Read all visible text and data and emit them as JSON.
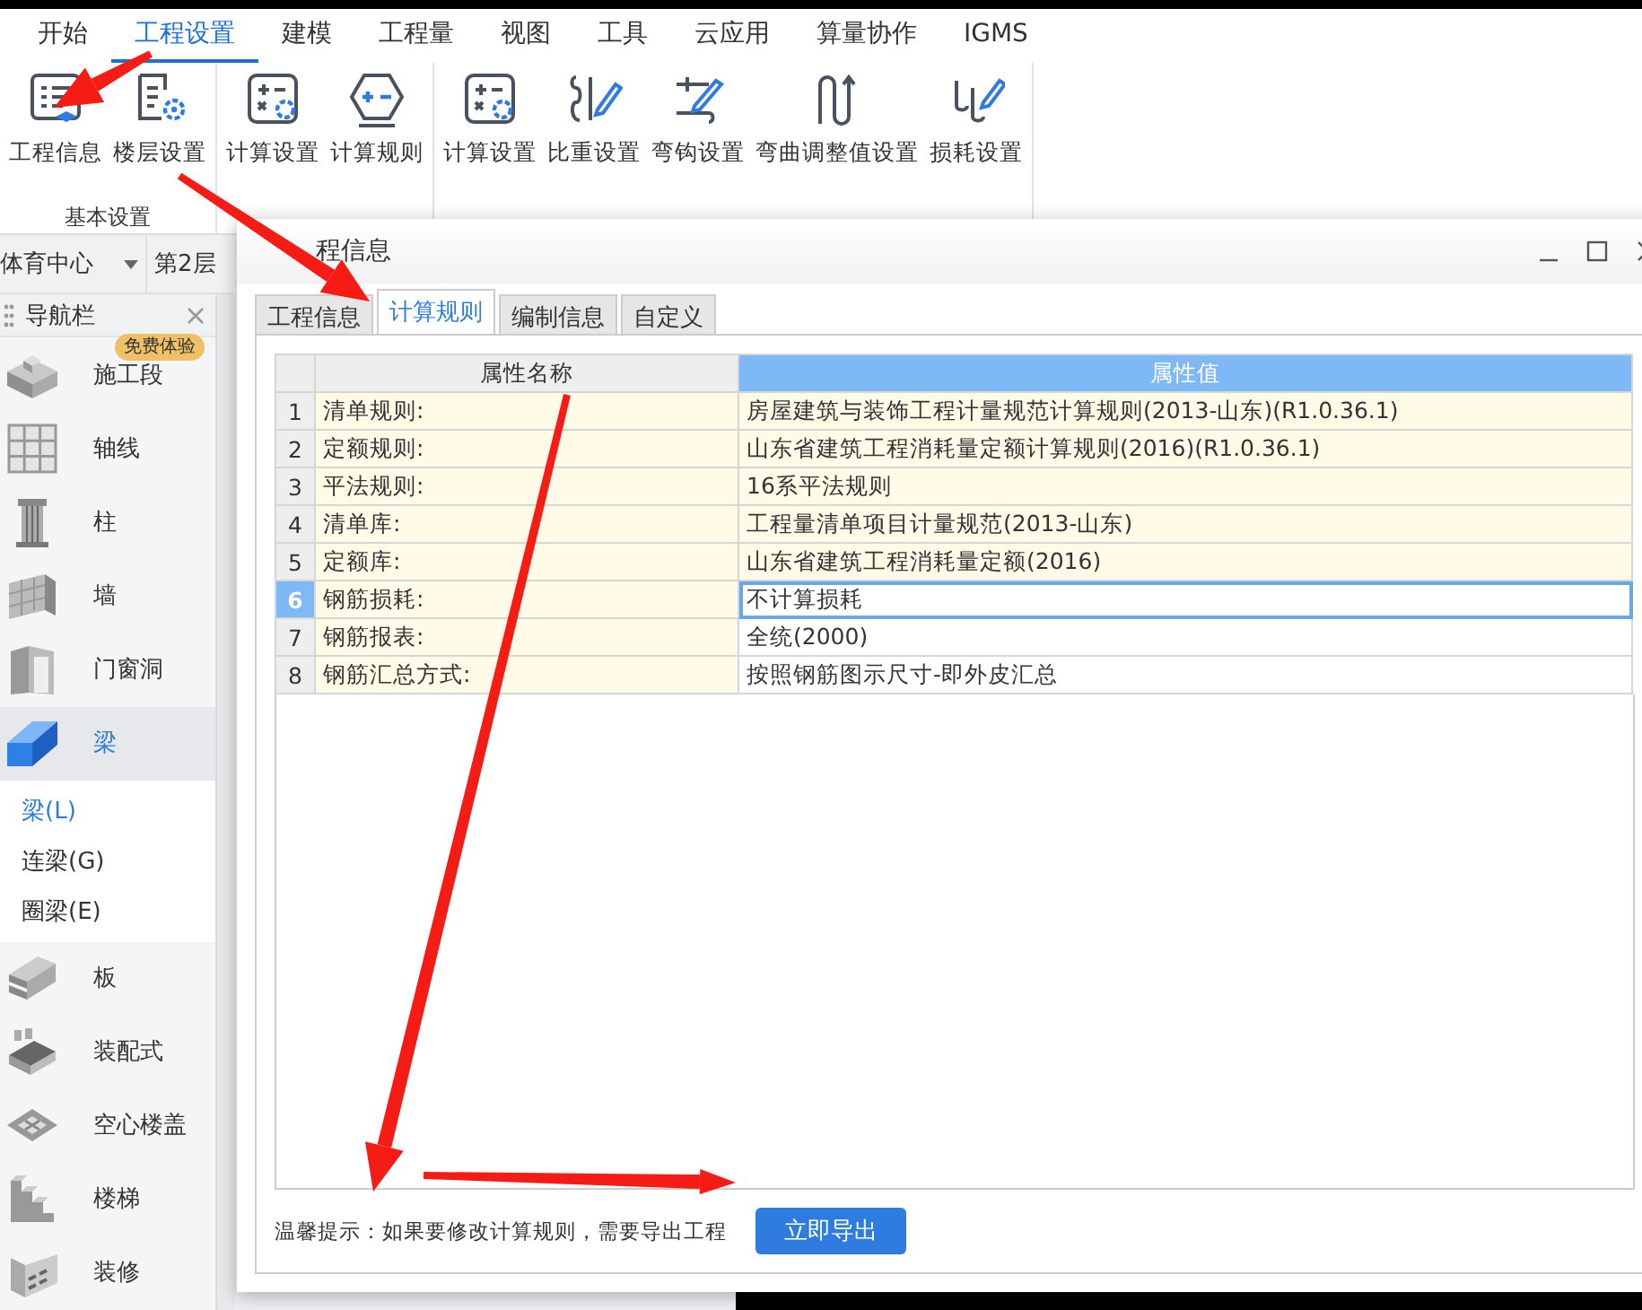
{
  "menu_tabs": [
    {
      "label": "开始",
      "selected": false
    },
    {
      "label": "工程设置",
      "selected": true
    },
    {
      "label": "建模",
      "selected": false
    },
    {
      "label": "工程量",
      "selected": false
    },
    {
      "label": "视图",
      "selected": false
    },
    {
      "label": "工具",
      "selected": false
    },
    {
      "label": "云应用",
      "selected": false
    },
    {
      "label": "算量协作",
      "selected": false
    },
    {
      "label": "IGMS",
      "selected": false
    }
  ],
  "ribbon_groups": [
    {
      "label": "基本设置",
      "buttons": [
        {
          "label": "工程信息",
          "kind": "docs"
        },
        {
          "label": "楼层设置",
          "kind": "docgear"
        }
      ]
    },
    {
      "buttons": [
        {
          "label": "计算设置",
          "kind": "calcgear"
        },
        {
          "label": "计算规则",
          "kind": "hexcalc"
        }
      ]
    },
    {
      "buttons": [
        {
          "label": "计算设置",
          "kind": "calcgear"
        },
        {
          "label": "比重设置",
          "kind": "barpencil"
        },
        {
          "label": "弯钩设置",
          "kind": "hookpencil"
        },
        {
          "label": "弯曲调整值设置",
          "kind": "wave"
        },
        {
          "label": "损耗设置",
          "kind": "hooks"
        }
      ]
    }
  ],
  "project_select": {
    "value": "体育中心"
  },
  "floor_select": {
    "value": "第2层"
  },
  "nav_panel": {
    "title": "导航栏",
    "badge": "免费体验",
    "items": [
      {
        "label": "施工段",
        "kind": "block",
        "selected": false
      },
      {
        "label": "轴线",
        "kind": "grid",
        "selected": false
      },
      {
        "label": "柱",
        "kind": "column",
        "selected": false
      },
      {
        "label": "墙",
        "kind": "wall",
        "selected": false
      },
      {
        "label": "门窗洞",
        "kind": "door",
        "selected": false
      },
      {
        "label": "梁",
        "kind": "beam",
        "selected": true,
        "children": [
          {
            "label": "梁(L)",
            "selected": true
          },
          {
            "label": "连梁(G)",
            "selected": false
          },
          {
            "label": "圈梁(E)",
            "selected": false
          }
        ]
      },
      {
        "label": "板",
        "kind": "slab",
        "selected": false
      },
      {
        "label": "装配式",
        "kind": "precast",
        "selected": false
      },
      {
        "label": "空心楼盖",
        "kind": "hollow",
        "selected": false
      },
      {
        "label": "楼梯",
        "kind": "stairs",
        "selected": false
      },
      {
        "label": "装修",
        "kind": "finish",
        "selected": false
      }
    ]
  },
  "dialog": {
    "title": "程信息",
    "tabs": [
      {
        "label": "工程信息",
        "selected": false
      },
      {
        "label": "计算规则",
        "selected": true
      },
      {
        "label": "编制信息",
        "selected": false
      },
      {
        "label": "自定义",
        "selected": false
      }
    ],
    "table": {
      "columns": [
        "属性名称",
        "属性值"
      ],
      "rows": [
        {
          "number": "1",
          "name": "清单规则:",
          "value": "房屋建筑与装饰工程计量规范计算规则(2013-山东)(R1.0.36.1)",
          "shaded": true,
          "selected": false
        },
        {
          "number": "2",
          "name": "定额规则:",
          "value": "山东省建筑工程消耗量定额计算规则(2016)(R1.0.36.1)",
          "shaded": true,
          "selected": false
        },
        {
          "number": "3",
          "name": "平法规则:",
          "value": "16系平法规则",
          "shaded": true,
          "selected": false
        },
        {
          "number": "4",
          "name": "清单库:",
          "value": "工程量清单项目计量规范(2013-山东)",
          "shaded": true,
          "selected": false
        },
        {
          "number": "5",
          "name": "定额库:",
          "value": "山东省建筑工程消耗量定额(2016)",
          "shaded": true,
          "selected": false
        },
        {
          "number": "6",
          "name": "钢筋损耗:",
          "value": "不计算损耗",
          "shaded": false,
          "selected": true
        },
        {
          "number": "7",
          "name": "钢筋报表:",
          "value": "全统(2000)",
          "shaded": false,
          "selected": false
        },
        {
          "number": "8",
          "name": "钢筋汇总方式:",
          "value": "按照钢筋图示尺寸-即外皮汇总",
          "shaded": false,
          "selected": false
        }
      ]
    },
    "hint": "温馨提示：如果要修改计算规则，需要导出工程",
    "button": "立即导出"
  }
}
